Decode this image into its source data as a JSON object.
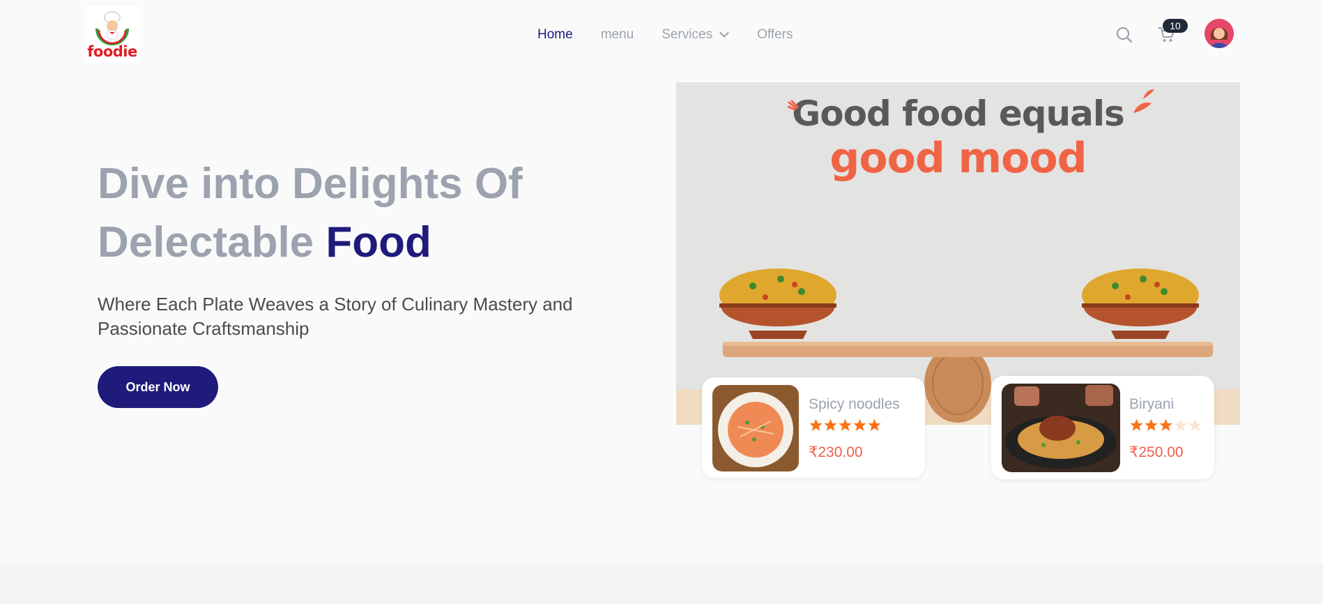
{
  "brand": {
    "logo_text": "foodie"
  },
  "nav": {
    "items": [
      {
        "label": "Home",
        "active": true
      },
      {
        "label": "menu",
        "active": false
      },
      {
        "label": "Services",
        "active": false,
        "has_dropdown": true
      },
      {
        "label": "Offers",
        "active": false
      }
    ]
  },
  "header": {
    "search_icon": "search-icon",
    "cart_icon": "cart-icon",
    "cart_count": "10",
    "avatar_icon": "user-avatar"
  },
  "hero": {
    "title_part1": "Dive into Delights Of Delectable",
    "title_accent": "Food",
    "subtitle": "Where Each Plate Weaves a Story of Culinary Mastery and Passionate Craftsmanship",
    "cta_label": "Order Now"
  },
  "banner": {
    "line1": "Good food equals",
    "line2": "good mood"
  },
  "products": [
    {
      "name": "Spicy noodles",
      "rating": 5,
      "max_rating": 5,
      "price": "₹230.00"
    },
    {
      "name": "Biryani",
      "rating": 3,
      "max_rating": 5,
      "price": "₹250.00"
    }
  ],
  "colors": {
    "primary": "#1e1b7b",
    "muted_text": "#9ca3af",
    "price": "#ef5f4c",
    "star_filled": "#f97316",
    "star_empty": "#fde4d4",
    "banner_orange": "#f06446"
  }
}
